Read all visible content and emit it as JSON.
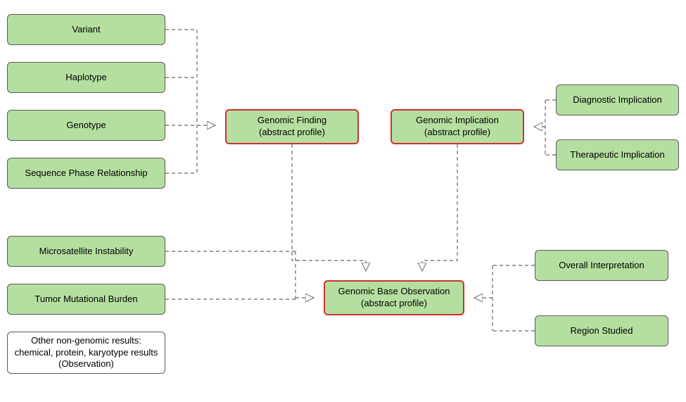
{
  "nodes": {
    "variant": "Variant",
    "haplotype": "Haplotype",
    "genotype": "Genotype",
    "sequence_phase": "Sequence Phase Relationship",
    "genomic_finding_l1": "Genomic Finding",
    "genomic_finding_l2": "(abstract profile)",
    "genomic_implication_l1": "Genomic Implication",
    "genomic_implication_l2": "(abstract profile)",
    "diagnostic_implication": "Diagnostic Implication",
    "therapeutic_implication": "Therapeutic Implication",
    "microsatellite": "Microsatellite Instability",
    "tumor_mutational": "Tumor Mutational Burden",
    "other_l1": "Other non-genomic results:",
    "other_l2": "chemical, protein, karyotype results",
    "other_l3": "(Observation)",
    "genomic_base_l1": "Genomic Base Observation",
    "genomic_base_l2": "(abstract profile)",
    "overall_interpretation": "Overall Interpretation",
    "region_studied": "Region Studied"
  }
}
